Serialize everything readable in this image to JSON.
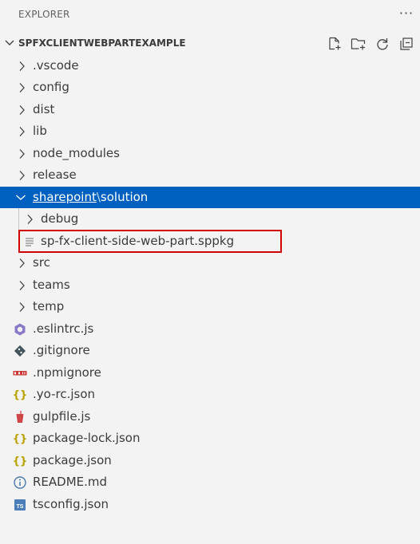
{
  "header": {
    "title": "EXPLORER",
    "more": "···"
  },
  "section": {
    "title": "SPFXCLIENTWEBPARTEXAMPLE"
  },
  "tree": {
    "folders_top": [
      ".vscode",
      "config",
      "dist",
      "lib",
      "node_modules",
      "release"
    ],
    "selected": {
      "segment1": "sharepoint",
      "separator": "\\",
      "segment2": "solution"
    },
    "debug": "debug",
    "package_file": "sp-fx-client-side-web-part.sppkg",
    "folders_bottom": [
      "src",
      "teams",
      "temp"
    ],
    "files": [
      {
        "name": ".eslintrc.js",
        "icon": "eslint-icon"
      },
      {
        "name": ".gitignore",
        "icon": "git-icon"
      },
      {
        "name": ".npmignore",
        "icon": "npm-icon"
      },
      {
        "name": ".yo-rc.json",
        "icon": "json-icon"
      },
      {
        "name": "gulpfile.js",
        "icon": "gulp-icon"
      },
      {
        "name": "package-lock.json",
        "icon": "json-icon"
      },
      {
        "name": "package.json",
        "icon": "json-icon"
      },
      {
        "name": "README.md",
        "icon": "info-icon"
      },
      {
        "name": "tsconfig.json",
        "icon": "typescript-icon"
      }
    ]
  },
  "colors": {
    "selected_bg": "#0060c0",
    "highlight": "#d00000"
  }
}
